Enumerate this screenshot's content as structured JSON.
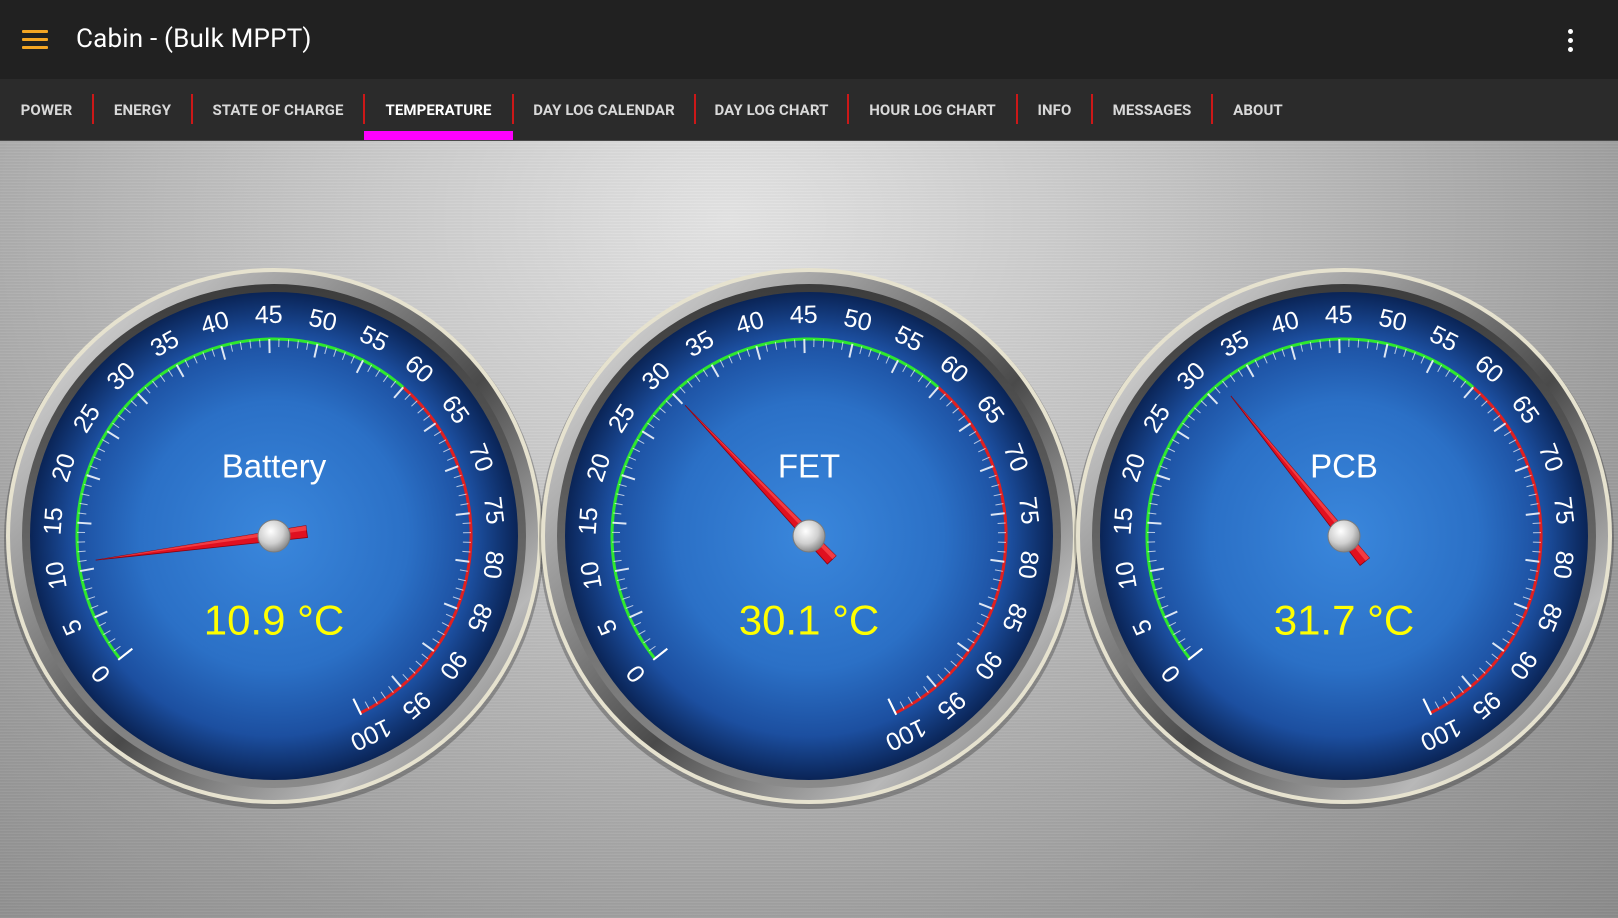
{
  "app_bar": {
    "title": "Cabin - (Bulk MPPT)",
    "menu_icon": "hamburger-menu-icon",
    "overflow_icon": "more-vertical-icon",
    "accent_color": "#f5a623"
  },
  "tabs": [
    {
      "label": "POWER",
      "active": false
    },
    {
      "label": "ENERGY",
      "active": false
    },
    {
      "label": "STATE OF CHARGE",
      "active": false
    },
    {
      "label": "TEMPERATURE",
      "active": true
    },
    {
      "label": "DAY LOG CALENDAR",
      "active": false
    },
    {
      "label": "DAY LOG CHART",
      "active": false
    },
    {
      "label": "HOUR LOG CHART",
      "active": false
    },
    {
      "label": "INFO",
      "active": false
    },
    {
      "label": "MESSAGES",
      "active": false
    },
    {
      "label": "ABOUT",
      "active": false
    }
  ],
  "colors": {
    "active_tab_indicator": "#ff00ff",
    "tab_divider": "#cc1818",
    "gauge_face": "#2f78cc",
    "gauge_green_arc": "#2ee82e",
    "gauge_red_arc": "#e02020",
    "needle": "#e01020",
    "value_text": "#ffff00"
  },
  "gauge_scale": {
    "min": 0,
    "max": 100,
    "major_step": 5,
    "green_range": [
      0,
      60
    ],
    "red_range": [
      60,
      100
    ],
    "unit": "°C"
  },
  "gauges": [
    {
      "label": "Battery",
      "value": 10.9,
      "display": "10.9 °C"
    },
    {
      "label": "FET",
      "value": 30.1,
      "display": "30.1 °C"
    },
    {
      "label": "PCB",
      "value": 31.7,
      "display": "31.7 °C"
    }
  ]
}
